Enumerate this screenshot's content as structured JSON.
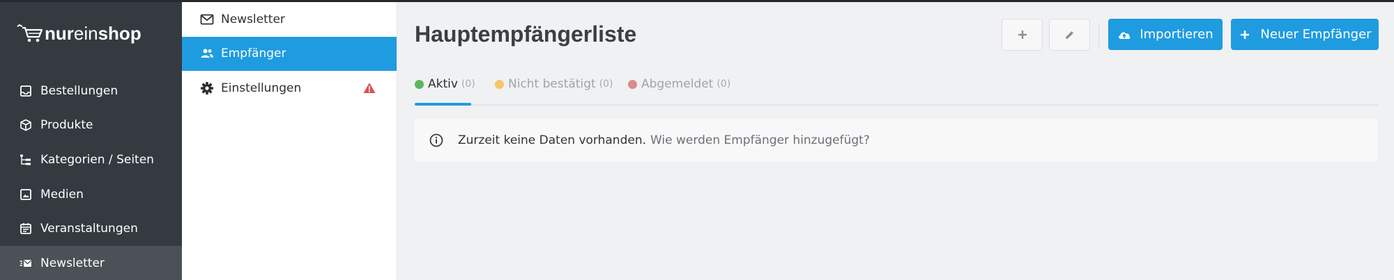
{
  "brand": {
    "logo_part1": "nur",
    "logo_part2": "ein",
    "logo_part3": "shop"
  },
  "sidebar": {
    "items": [
      {
        "label": "Bestellungen",
        "icon": "inbox-icon"
      },
      {
        "label": "Produkte",
        "icon": "box-icon"
      },
      {
        "label": "Kategorien / Seiten",
        "icon": "tree-icon"
      },
      {
        "label": "Medien",
        "icon": "image-icon"
      },
      {
        "label": "Veranstaltungen",
        "icon": "calendar-icon"
      },
      {
        "label": "Newsletter",
        "icon": "newsletter-icon",
        "active": true
      }
    ]
  },
  "subnav": {
    "items": [
      {
        "label": "Newsletter",
        "icon": "envelope-icon"
      },
      {
        "label": "Empfänger",
        "icon": "users-icon",
        "active": true
      },
      {
        "label": "Einstellungen",
        "icon": "gear-icon",
        "warning": true
      }
    ]
  },
  "main": {
    "title": "Hauptempfängerliste",
    "buttons": {
      "import_label": "Importieren",
      "new_label": "Neuer Empfänger"
    },
    "tabs": [
      {
        "label": "Aktiv",
        "count": "(0)",
        "dot_color": "#5cb85c",
        "active": true
      },
      {
        "label": "Nicht bestätigt",
        "count": "(0)",
        "dot_color": "#f5c46b"
      },
      {
        "label": "Abgemeldet",
        "count": "(0)",
        "dot_color": "#d98c8c"
      }
    ],
    "info": {
      "text": "Zurzeit keine Daten vorhanden.",
      "link": "Wie werden Empfänger hinzugefügt?"
    }
  },
  "colors": {
    "accent": "#1f9be0",
    "sidebar_bg": "#343a40",
    "warning": "#d9534f"
  }
}
